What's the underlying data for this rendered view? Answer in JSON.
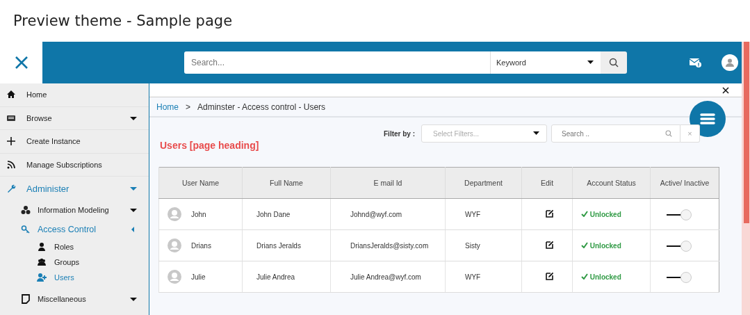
{
  "window": {
    "title": "Preview theme - Sample page"
  },
  "header": {
    "search": {
      "placeholder": "Search..."
    },
    "search_type": {
      "value": "Keyword"
    }
  },
  "sidebar": {
    "items": [
      {
        "label": "Home",
        "selected": false
      },
      {
        "label": "Browse",
        "selected": false,
        "expanded": false
      },
      {
        "label": "Create Instance",
        "selected": false
      },
      {
        "label": "Manage Subscriptions",
        "selected": false
      },
      {
        "label": "Administer",
        "selected": true,
        "expanded": true,
        "children": [
          {
            "label": "Information Modeling",
            "selected": false,
            "expanded": false
          },
          {
            "label": "Access Control",
            "selected": true,
            "expanded": true,
            "children": [
              {
                "label": "Roles",
                "selected": false
              },
              {
                "label": "Groups",
                "selected": false
              },
              {
                "label": "Users",
                "selected": true
              }
            ]
          },
          {
            "label": "Miscellaneous",
            "selected": false,
            "expanded": false
          }
        ]
      }
    ]
  },
  "breadcrumb": [
    {
      "label": "Home",
      "kind": "link"
    },
    {
      "label": ">",
      "kind": "separator"
    },
    {
      "label": "Adminster - Access control - Users",
      "kind": "current"
    }
  ],
  "page": {
    "heading": "Users [page heading]",
    "filter_label": "Filter by :",
    "filter_select": {
      "placeholder": "Select Filters..."
    },
    "filter_search": {
      "placeholder": "Search .."
    },
    "clear_button": {
      "label": "×"
    }
  },
  "table": {
    "columns": [
      "User Name",
      "Full Name",
      "E mail Id",
      "Department",
      "Edit",
      "Account Status",
      "Active/ Inactive"
    ],
    "rows": [
      {
        "user_name": "John",
        "full_name": "John Dane",
        "email": "Johnd@wyf.com",
        "department": "WYF",
        "status": "Unlocked",
        "active": true
      },
      {
        "user_name": "Drians",
        "full_name": "Drians Jeralds",
        "email": "DriansJeralds@sisty.com",
        "department": "Sisty",
        "status": "Unlocked",
        "active": true
      },
      {
        "user_name": "Julie",
        "full_name": "Julie Andrea",
        "email": "Julie Andrea@wyf.com",
        "department": "WYF",
        "status": "Unlocked",
        "active": true
      }
    ]
  }
}
